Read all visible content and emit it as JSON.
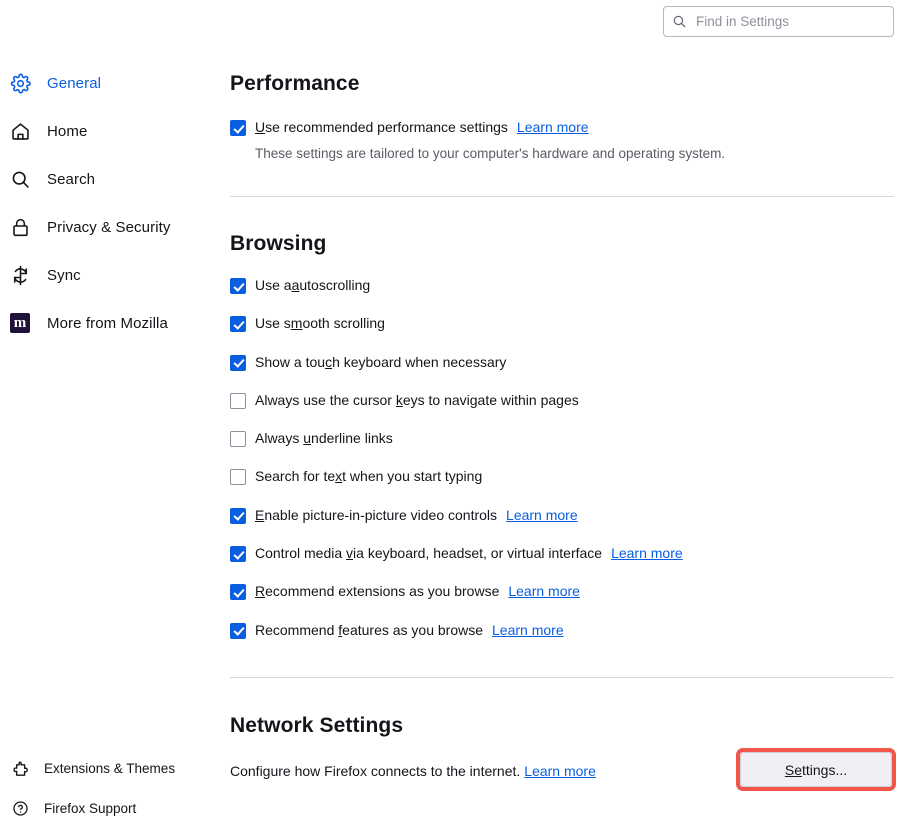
{
  "search": {
    "placeholder": "Find in Settings",
    "value": "",
    "icon": "search-icon"
  },
  "sidebar": {
    "items": [
      {
        "label": "General",
        "icon": "gear-icon",
        "active": true
      },
      {
        "label": "Home",
        "icon": "home-icon",
        "active": false
      },
      {
        "label": "Search",
        "icon": "search-icon",
        "active": false
      },
      {
        "label": "Privacy & Security",
        "icon": "lock-icon",
        "active": false
      },
      {
        "label": "Sync",
        "icon": "sync-icon",
        "active": false
      },
      {
        "label": "More from Mozilla",
        "icon": "mozilla-m-icon",
        "active": false
      }
    ],
    "bottom_items": [
      {
        "label": "Extensions & Themes",
        "icon": "puzzle-piece-icon"
      },
      {
        "label": "Firefox Support",
        "icon": "question-circle-icon"
      }
    ]
  },
  "performance": {
    "title": "Performance",
    "checkbox": {
      "pre": "U",
      "post": "se recommended performance settings",
      "checked": true,
      "learn_more": "Learn more"
    },
    "description": "These settings are tailored to your computer's hardware and operating system."
  },
  "browsing": {
    "title": "Browsing",
    "options": [
      {
        "pre": "Use a",
        "key": "a",
        "post": "utoscrolling",
        "checked": true,
        "learn_more": ""
      },
      {
        "pre": "Use s",
        "key": "m",
        "post": "ooth scrolling",
        "checked": true,
        "learn_more": ""
      },
      {
        "pre": "Show a tou",
        "key": "c",
        "post": "h keyboard when necessary",
        "checked": true,
        "learn_more": ""
      },
      {
        "pre": "Always use the cursor ",
        "key": "k",
        "post": "eys to navigate within pages",
        "checked": false,
        "learn_more": ""
      },
      {
        "pre": "Always ",
        "key": "u",
        "post": "nderline links",
        "checked": false,
        "learn_more": ""
      },
      {
        "pre": "Search for te",
        "key": "x",
        "post": "t when you start typing",
        "checked": false,
        "learn_more": ""
      },
      {
        "pre": "",
        "key": "E",
        "post": "nable picture-in-picture video controls",
        "checked": true,
        "learn_more": "Learn more"
      },
      {
        "pre": "Control media ",
        "key": "v",
        "post": "ia keyboard, headset, or virtual interface",
        "checked": true,
        "learn_more": "Learn more"
      },
      {
        "pre": "",
        "key": "R",
        "post": "ecommend extensions as you browse",
        "checked": true,
        "learn_more": "Learn more"
      },
      {
        "pre": "Recommend ",
        "key": "f",
        "post": "eatures as you browse",
        "checked": true,
        "learn_more": "Learn more"
      }
    ]
  },
  "network": {
    "title": "Network Settings",
    "description": "Configure how Firefox connects to the internet.",
    "learn_more": "Learn more",
    "button": {
      "pre": "S",
      "key": "e",
      "post": "ttings...",
      "highlighted": true,
      "highlight_color": "#f2564a"
    }
  },
  "colors": {
    "accent": "#0a5ee0",
    "link": "#0a5ee0",
    "text": "#15141a",
    "muted": "#5b5b66",
    "divider": "#d7d7db",
    "highlight": "#f2564a",
    "button_bg": "#f0f0f4"
  }
}
